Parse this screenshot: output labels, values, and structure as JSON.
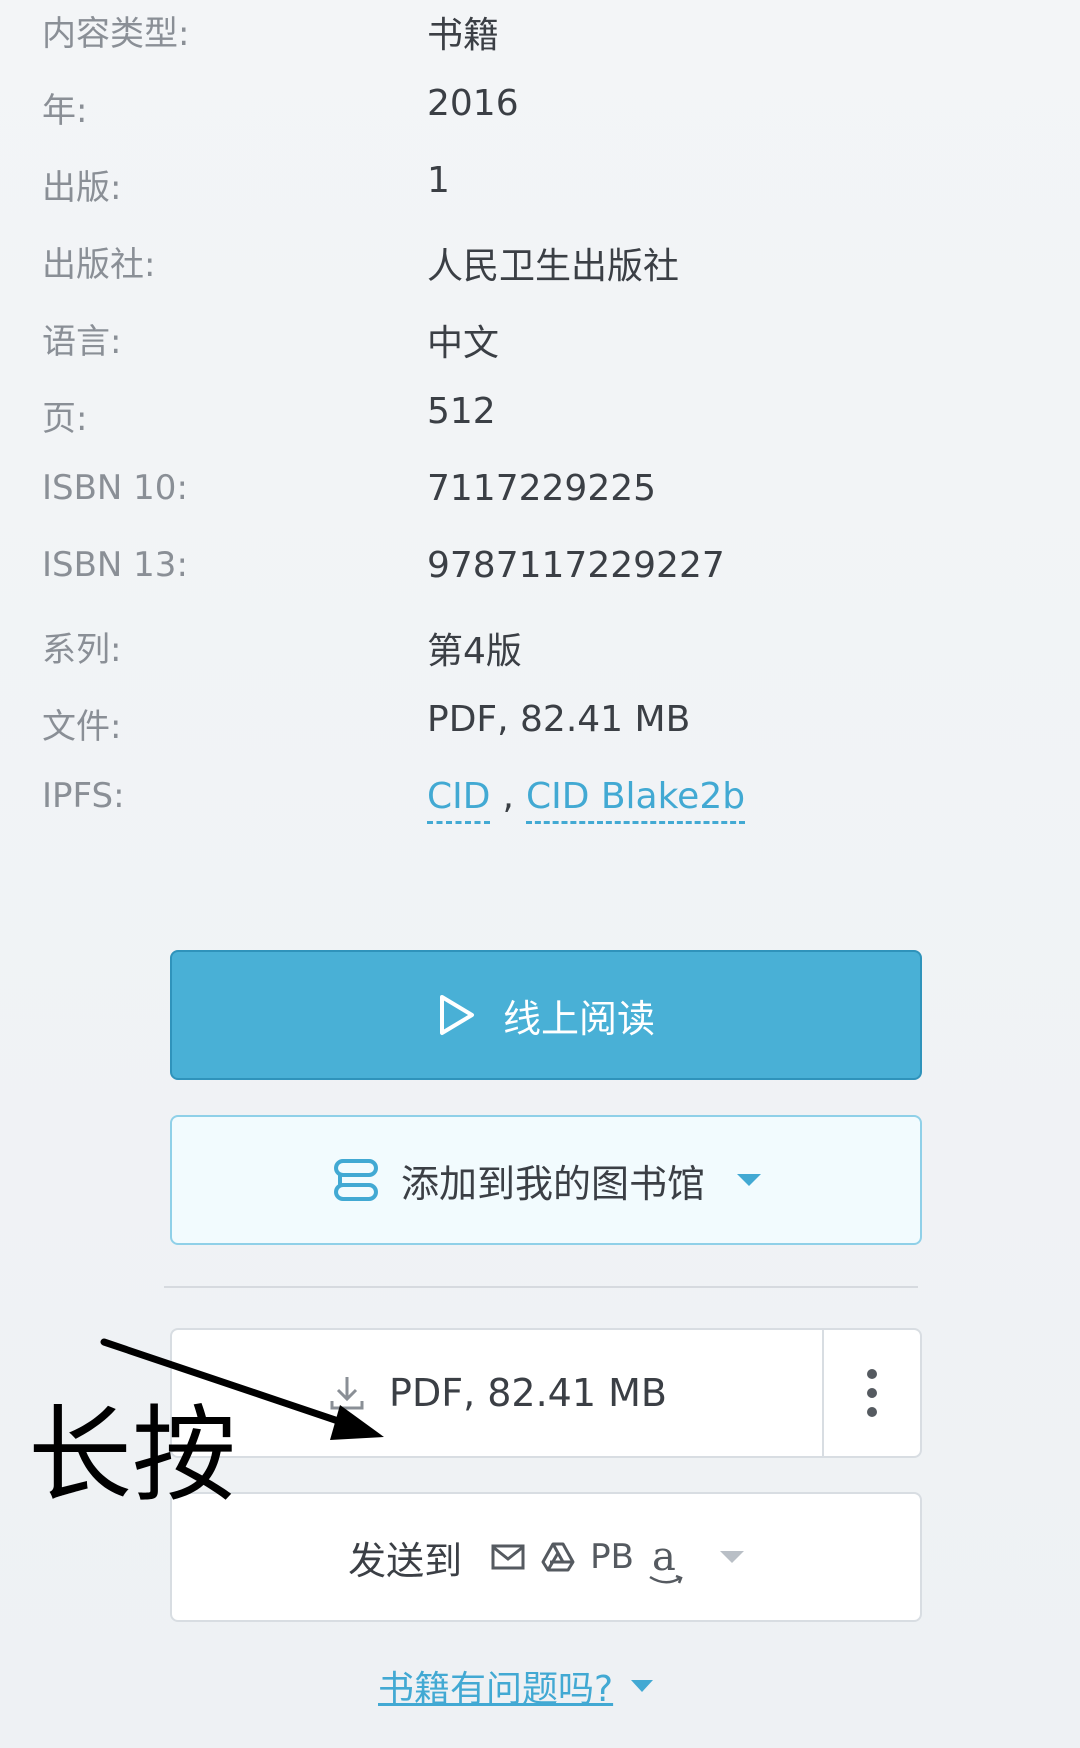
{
  "details": [
    {
      "label": "内容类型:",
      "value": "书籍"
    },
    {
      "label": "年:",
      "value": "2016"
    },
    {
      "label": "出版:",
      "value": "1"
    },
    {
      "label": "出版社:",
      "value": "人民卫生出版社"
    },
    {
      "label": "语言:",
      "value": "中文"
    },
    {
      "label": "页:",
      "value": "512"
    },
    {
      "label": "ISBN 10:",
      "value": "7117229225"
    },
    {
      "label": "ISBN 13:",
      "value": "9787117229227"
    },
    {
      "label": "系列:",
      "value": "第4版"
    },
    {
      "label": "文件:",
      "value": "PDF, 82.41 MB"
    }
  ],
  "ipfs": {
    "label": "IPFS:",
    "link1": "CID",
    "separator": ",",
    "link2": "CID Blake2b"
  },
  "actions": {
    "read_online": "线上阅读",
    "add_to_library": "添加到我的图书馆",
    "download": "PDF, 82.41 MB",
    "send_to": "发送到",
    "send_pb": "PB",
    "send_amazon": "a",
    "problem_link": "书籍有问题吗?"
  },
  "annotation": {
    "text": "长按"
  },
  "colors": {
    "accent": "#42a9d3",
    "primary_button": "#49b0d6",
    "label_gray": "#8a8f96"
  },
  "icons": [
    "play-icon",
    "library-icon",
    "download-icon",
    "more-vertical-icon",
    "mail-icon",
    "google-drive-icon",
    "pocketbook-icon",
    "amazon-icon",
    "caret-down-icon"
  ]
}
